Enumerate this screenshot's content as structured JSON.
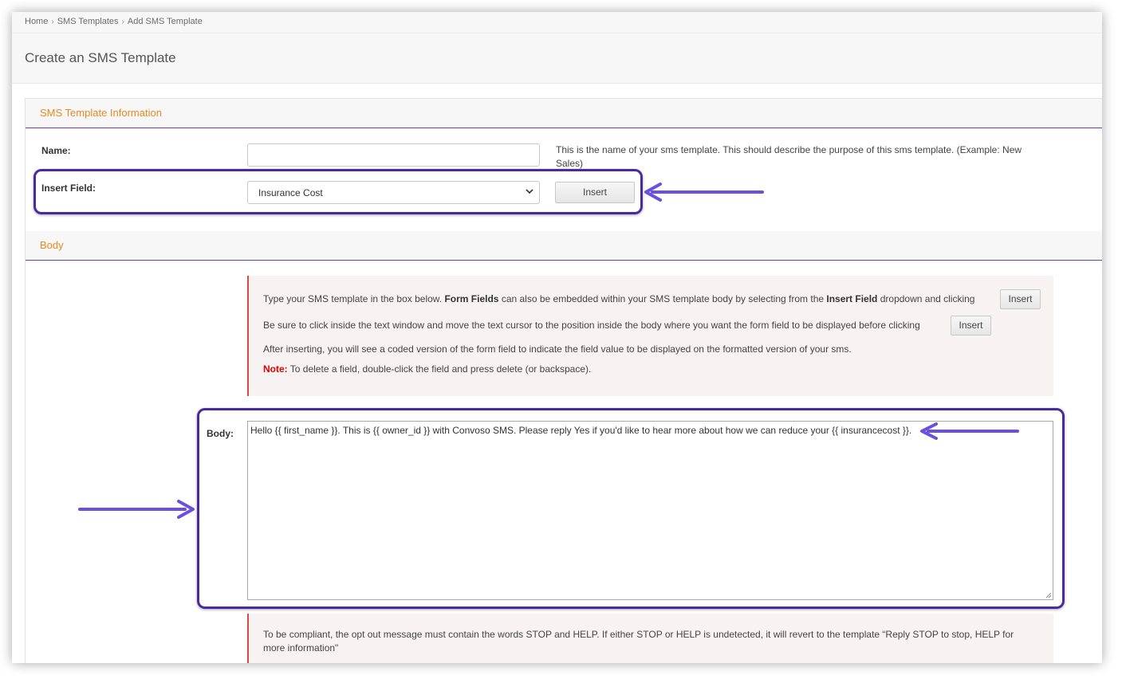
{
  "breadcrumb": [
    "Home",
    "SMS Templates",
    "Add SMS Template"
  ],
  "page_title": "Create an SMS Template",
  "sections": {
    "info_title": "SMS Template Information",
    "body_title": "Body"
  },
  "form": {
    "name_label": "Name:",
    "name_value": "",
    "name_help": "This is the name of your sms template. This should describe the purpose of this sms template. (Example: New Sales)",
    "insert_field_label": "Insert Field:",
    "insert_field_selected": "Insurance Cost",
    "insert_button": "Insert"
  },
  "instructions": {
    "line1_pre": "Type your SMS template in the box below.  ",
    "line1_bold1": "Form Fields",
    "line1_mid": " can also be embedded within your SMS template body by selecting from the ",
    "line1_bold2": "Insert Field",
    "line1_post": " dropdown and clicking",
    "line2": "Be sure to click inside the text window and move the text cursor to the position inside the body where you want the form field to be displayed before clicking",
    "line3": "After inserting, you will see a coded version of the form field to indicate the field value to be displayed on the formatted version of your sms.",
    "note_label": "Note:",
    "note_text": " To delete a field, double-click the field and press delete (or backspace).",
    "insert_button": "Insert"
  },
  "body": {
    "label": "Body:",
    "value": "Hello {{ first_name }}. This is {{ owner_id }} with Convoso SMS. Please reply Yes if you'd like to hear more about how we can reduce your {{ insurancecost }}."
  },
  "compliance": "To be compliant, the opt out message must contain the words STOP and HELP. If either STOP or HELP is undetected, it will revert to the template “Reply STOP to stop, HELP for more information\"",
  "colors": {
    "accent_orange": "#e8891f",
    "callout_purple": "#4a2a9e",
    "arrow_purple": "#6b4fe0",
    "note_red": "#e00000"
  }
}
